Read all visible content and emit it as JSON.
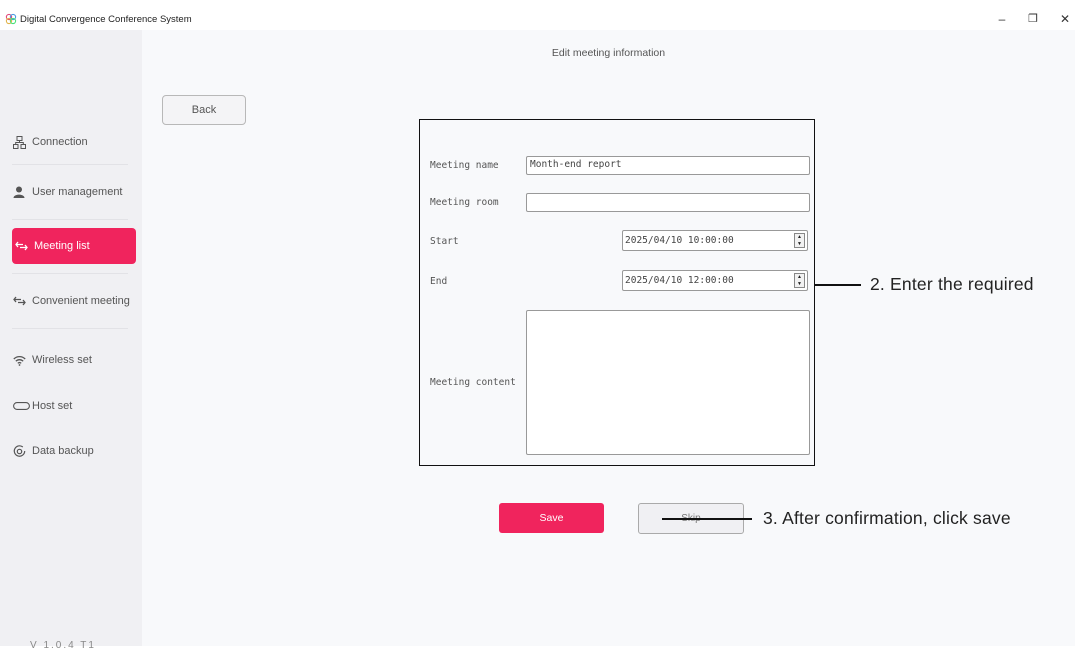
{
  "window": {
    "title": "Digital Convergence Conference System",
    "minimize": "–",
    "maximize": "❐",
    "close": "✕"
  },
  "sidebar": {
    "items": [
      {
        "label": "Connection",
        "icon": "connection-icon"
      },
      {
        "label": "User management",
        "icon": "user-icon"
      },
      {
        "label": "Meeting list",
        "icon": "arrows-icon",
        "active": true
      },
      {
        "label": "Convenient meeting",
        "icon": "arrows-icon"
      },
      {
        "label": "Wireless set",
        "icon": "wifi-icon"
      },
      {
        "label": "Host set",
        "icon": "host-icon"
      },
      {
        "label": "Data backup",
        "icon": "backup-icon"
      }
    ],
    "version": "V 1.0.4 T1"
  },
  "main": {
    "page_title": "Edit meeting information",
    "back_label": "Back"
  },
  "form": {
    "meeting_name_label": "Meeting name",
    "meeting_name_value": "Month-end report",
    "meeting_room_label": "Meeting room",
    "meeting_room_value": "",
    "start_label": "Start",
    "start_value": "2025/04/10 10:00:00",
    "end_label": "End",
    "end_value": "2025/04/10 12:00:00",
    "content_label": "Meeting content",
    "content_value": ""
  },
  "actions": {
    "save_label": "Save",
    "skip_label": "Skip"
  },
  "annotations": {
    "step2": "2. Enter the required",
    "step3": "3. After confirmation, click save"
  },
  "colors": {
    "accent": "#f0245d",
    "sidebar_bg": "#f0f0f3",
    "main_bg": "#f8f9fb"
  }
}
